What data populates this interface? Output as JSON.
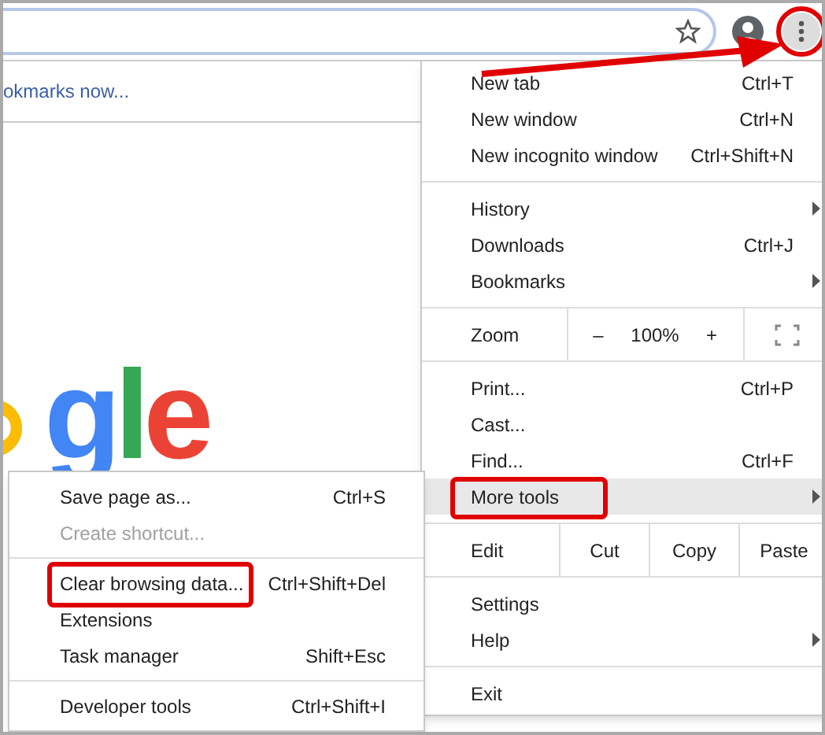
{
  "toolbar": {
    "menu_button": {
      "annotated": true
    }
  },
  "bookmarks_bar": {
    "text": "okmarks now..."
  },
  "logo": {
    "letters": [
      {
        "char": "g",
        "color": "#4285f4"
      },
      {
        "char": "l",
        "color": "#34a853"
      },
      {
        "char": "e",
        "color": "#ea4335"
      }
    ]
  },
  "menu": {
    "items": [
      {
        "kind": "item",
        "label": "New tab",
        "shortcut": "Ctrl+T",
        "submenu": false,
        "selected": false,
        "annotated": false
      },
      {
        "kind": "item",
        "label": "New window",
        "shortcut": "Ctrl+N",
        "submenu": false,
        "selected": false,
        "annotated": false
      },
      {
        "kind": "item",
        "label": "New incognito window",
        "shortcut": "Ctrl+Shift+N",
        "submenu": false,
        "selected": false,
        "annotated": false
      },
      {
        "kind": "divider"
      },
      {
        "kind": "item",
        "label": "History",
        "submenu": true,
        "selected": false,
        "annotated": false
      },
      {
        "kind": "item",
        "label": "Downloads",
        "shortcut": "Ctrl+J",
        "submenu": false,
        "selected": false,
        "annotated": false
      },
      {
        "kind": "item",
        "label": "Bookmarks",
        "submenu": true,
        "selected": false,
        "annotated": false
      },
      {
        "kind": "zoom",
        "label": "Zoom",
        "minus": "–",
        "value": "100%",
        "plus": "+"
      },
      {
        "kind": "item",
        "label": "Print...",
        "shortcut": "Ctrl+P",
        "submenu": false,
        "selected": false,
        "annotated": false
      },
      {
        "kind": "item",
        "label": "Cast...",
        "submenu": false,
        "selected": false,
        "annotated": false
      },
      {
        "kind": "item",
        "label": "Find...",
        "shortcut": "Ctrl+F",
        "submenu": false,
        "selected": false,
        "annotated": false
      },
      {
        "kind": "item",
        "label": "More tools",
        "submenu": true,
        "selected": true,
        "annotated": true
      },
      {
        "kind": "edit",
        "label": "Edit",
        "buttons": [
          "Cut",
          "Copy",
          "Paste"
        ]
      },
      {
        "kind": "item",
        "label": "Settings",
        "submenu": false,
        "selected": false,
        "annotated": false
      },
      {
        "kind": "item",
        "label": "Help",
        "submenu": true,
        "selected": false,
        "annotated": false
      },
      {
        "kind": "divider"
      },
      {
        "kind": "item",
        "label": "Exit",
        "submenu": false,
        "selected": false,
        "annotated": false
      }
    ]
  },
  "submenu": {
    "items": [
      {
        "kind": "item",
        "label": "Save page as...",
        "shortcut": "Ctrl+S",
        "disabled": false,
        "annotated": false
      },
      {
        "kind": "item",
        "label": "Create shortcut...",
        "disabled": true,
        "annotated": false
      },
      {
        "kind": "divider"
      },
      {
        "kind": "item",
        "label": "Clear browsing data...",
        "shortcut": "Ctrl+Shift+Del",
        "disabled": false,
        "annotated": true
      },
      {
        "kind": "item",
        "label": "Extensions",
        "disabled": false,
        "annotated": false
      },
      {
        "kind": "item",
        "label": "Task manager",
        "shortcut": "Shift+Esc",
        "disabled": false,
        "annotated": false
      },
      {
        "kind": "divider"
      },
      {
        "kind": "item",
        "label": "Developer tools",
        "shortcut": "Ctrl+Shift+I",
        "disabled": false,
        "annotated": false
      }
    ]
  }
}
